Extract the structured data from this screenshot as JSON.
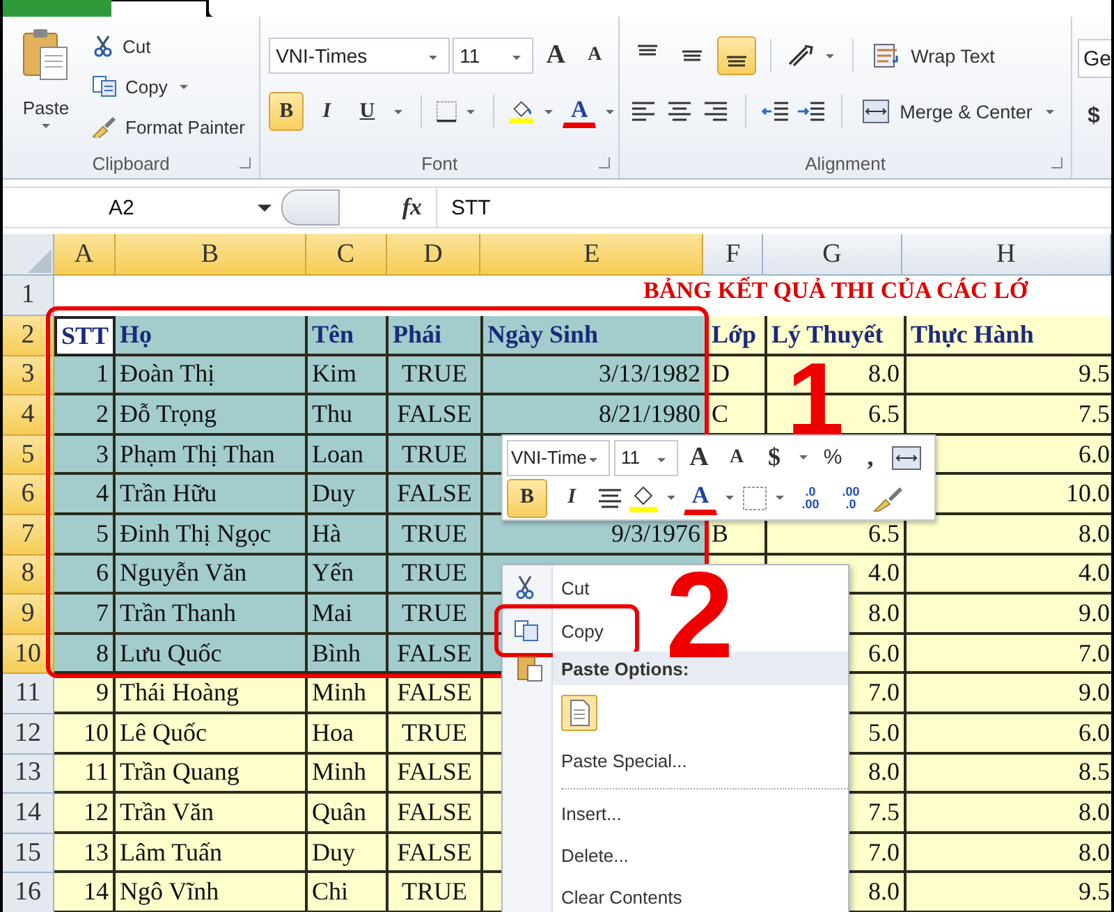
{
  "ribbon": {
    "clipboard": {
      "paste": "Paste",
      "commands": [
        {
          "kind": "cut",
          "label": "Cut",
          "dropdown": false
        },
        {
          "kind": "copy",
          "label": "Copy",
          "dropdown": true
        },
        {
          "kind": "painter",
          "label": "Format Painter",
          "dropdown": false
        }
      ],
      "group_label": "Clipboard"
    },
    "font": {
      "font_name": "VNI-Times",
      "font_size": "11",
      "grow": "A",
      "shrink": "A",
      "styles": [
        {
          "label": "B",
          "selected": true
        },
        {
          "label": "I",
          "selected": false
        },
        {
          "label": "U",
          "selected": false
        }
      ],
      "font_color": "A",
      "group_label": "Font"
    },
    "alignment": {
      "vertical": [
        {
          "selected": false
        },
        {
          "selected": false
        },
        {
          "selected": true
        }
      ],
      "wrap_text": "Wrap Text",
      "merge": "Merge & Center",
      "group_label": "Alignment"
    },
    "number": {
      "format": "Ge",
      "currency": "$"
    }
  },
  "formula_bar": {
    "name_box": "A2",
    "fx": "fx",
    "value": "STT"
  },
  "sheet": {
    "columns": [
      {
        "label": "A",
        "selected": true
      },
      {
        "label": "B",
        "selected": true
      },
      {
        "label": "C",
        "selected": true
      },
      {
        "label": "D",
        "selected": true
      },
      {
        "label": "E",
        "selected": true
      },
      {
        "label": "F",
        "selected": false
      },
      {
        "label": "G",
        "selected": false
      },
      {
        "label": "H",
        "selected": false
      }
    ],
    "title_row": {
      "number": "1",
      "title": "BẢNG KẾT QUẢ THI CỦA CÁC LỚ"
    },
    "rows": [
      {
        "number": "2",
        "selected": true,
        "kind": "header",
        "cells": [
          "STT",
          "Họ",
          "Tên",
          "Phái",
          "Ngày Sinh",
          "Lớp",
          "Lý Thuyết",
          "Thực Hành"
        ]
      },
      {
        "number": "3",
        "selected": true,
        "kind": "data",
        "cells": [
          "1",
          "Đoàn Thị",
          "Kim",
          "TRUE",
          "3/13/1982",
          "D",
          "8.0",
          "9.5"
        ]
      },
      {
        "number": "4",
        "selected": true,
        "kind": "data",
        "cells": [
          "2",
          "Đỗ Trọng",
          "Thu",
          "FALSE",
          "8/21/1980",
          "C",
          "6.5",
          "7.5"
        ]
      },
      {
        "number": "5",
        "selected": true,
        "kind": "data",
        "cells": [
          "3",
          "Phạm Thị Than",
          "Loan",
          "TRUE",
          null,
          null,
          null,
          "6.0"
        ]
      },
      {
        "number": "6",
        "selected": true,
        "kind": "data",
        "cells": [
          "4",
          "Trần Hữu",
          "Duy",
          "FALSE",
          null,
          null,
          null,
          "10.0"
        ]
      },
      {
        "number": "7",
        "selected": true,
        "kind": "data",
        "cells": [
          "5",
          "Đinh Thị Ngọc",
          "Hà",
          "TRUE",
          "9/3/1976",
          "B",
          "6.5",
          "8.0"
        ]
      },
      {
        "number": "8",
        "selected": true,
        "kind": "data",
        "cells": [
          "6",
          "Nguyễn Văn",
          "Yến",
          "TRUE",
          null,
          null,
          "4.0",
          "4.0"
        ]
      },
      {
        "number": "9",
        "selected": true,
        "kind": "data",
        "cells": [
          "7",
          "Trần Thanh",
          "Mai",
          "TRUE",
          null,
          null,
          "8.0",
          "9.0"
        ]
      },
      {
        "number": "10",
        "selected": true,
        "kind": "data",
        "cells": [
          "8",
          "Lưu Quốc",
          "Bình",
          "FALSE",
          null,
          null,
          "6.0",
          "7.0"
        ]
      },
      {
        "number": "11",
        "selected": false,
        "kind": "data",
        "cells": [
          "9",
          "Thái Hoàng",
          "Minh",
          "FALSE",
          null,
          null,
          "7.0",
          "9.0"
        ]
      },
      {
        "number": "12",
        "selected": false,
        "kind": "data",
        "cells": [
          "10",
          "Lê Quốc",
          "Hoa",
          "TRUE",
          null,
          null,
          "5.0",
          "6.0"
        ]
      },
      {
        "number": "13",
        "selected": false,
        "kind": "data",
        "cells": [
          "11",
          "Trần Quang",
          "Minh",
          "FALSE",
          null,
          null,
          "8.0",
          "8.5"
        ]
      },
      {
        "number": "14",
        "selected": false,
        "kind": "data",
        "cells": [
          "12",
          "Trần Văn",
          "Quân",
          "FALSE",
          null,
          null,
          "7.5",
          "8.0"
        ]
      },
      {
        "number": "15",
        "selected": false,
        "kind": "data",
        "cells": [
          "13",
          "Lâm Tuấn",
          "Duy",
          "FALSE",
          null,
          null,
          "7.0",
          "8.0"
        ]
      },
      {
        "number": "16",
        "selected": false,
        "kind": "data",
        "cells": [
          "14",
          "Ngô Vĩnh",
          "Chi",
          "TRUE",
          null,
          null,
          "8.0",
          "9.5"
        ]
      }
    ]
  },
  "mini_toolbar": {
    "font_name": "VNI-Time",
    "font_size": "11",
    "grow": "A",
    "shrink": "A",
    "currency": "$",
    "percent": "%",
    "comma": ",",
    "bold": {
      "label": "B",
      "selected": true
    },
    "italic": "I",
    "font_color": "A",
    "decimals": [
      {
        "top": ".0",
        "bottom": ".00"
      },
      {
        "top": ".00",
        "bottom": ".0"
      }
    ]
  },
  "context_menu": {
    "items": [
      {
        "kind": "cut",
        "label": "Cut",
        "highlighted": false
      },
      {
        "kind": "copy",
        "label": "Copy",
        "highlighted": true
      },
      {
        "kind": "heading",
        "label": "Paste Options:",
        "highlighted": false
      },
      {
        "kind": "paste-option"
      },
      {
        "kind": "command",
        "label": "Paste Special...",
        "highlighted": false
      },
      {
        "kind": "separator"
      },
      {
        "kind": "command",
        "label": "Insert...",
        "highlighted": false
      },
      {
        "kind": "command",
        "label": "Delete...",
        "highlighted": false
      },
      {
        "kind": "command",
        "label": "Clear Contents",
        "highlighted": false
      }
    ]
  },
  "steps": [
    {
      "label": "1"
    },
    {
      "label": "2"
    }
  ]
}
